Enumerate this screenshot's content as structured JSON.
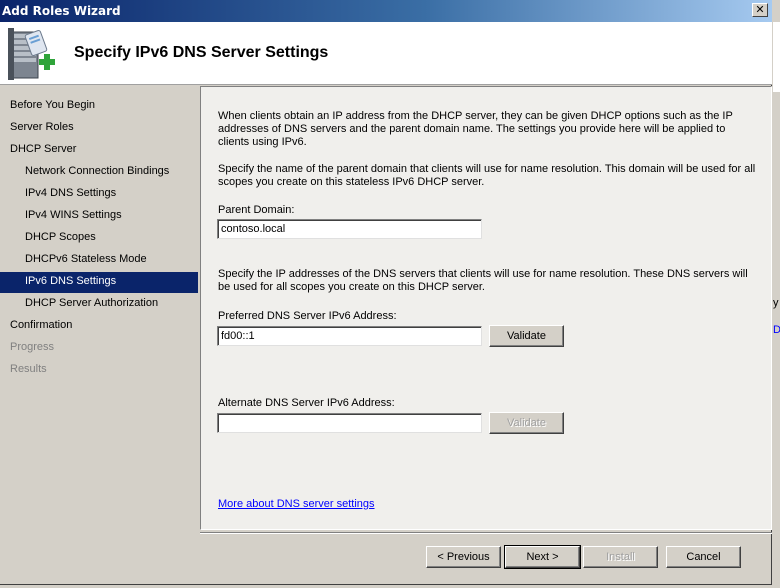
{
  "window": {
    "title": "Add Roles Wizard",
    "close_glyph": "✕"
  },
  "header": {
    "title": "Specify IPv6 DNS Server Settings",
    "icon": "server-add-role-icon"
  },
  "nav": {
    "items": [
      {
        "label": "Before You Begin",
        "level": 1,
        "state": "normal"
      },
      {
        "label": "Server Roles",
        "level": 1,
        "state": "normal"
      },
      {
        "label": "DHCP Server",
        "level": 1,
        "state": "normal"
      },
      {
        "label": "Network Connection Bindings",
        "level": 2,
        "state": "normal"
      },
      {
        "label": "IPv4 DNS Settings",
        "level": 2,
        "state": "normal"
      },
      {
        "label": "IPv4 WINS Settings",
        "level": 2,
        "state": "normal"
      },
      {
        "label": "DHCP Scopes",
        "level": 2,
        "state": "normal"
      },
      {
        "label": "DHCPv6 Stateless Mode",
        "level": 2,
        "state": "normal"
      },
      {
        "label": "IPv6 DNS Settings",
        "level": 2,
        "state": "selected"
      },
      {
        "label": "DHCP Server Authorization",
        "level": 2,
        "state": "normal"
      },
      {
        "label": "Confirmation",
        "level": 1,
        "state": "normal"
      },
      {
        "label": "Progress",
        "level": 1,
        "state": "disabled"
      },
      {
        "label": "Results",
        "level": 1,
        "state": "disabled"
      }
    ]
  },
  "content": {
    "intro": "When clients obtain an IP address from the DHCP server, they can be given DHCP options such as the IP addresses of DNS servers and the parent domain name. The settings you provide here will be applied to clients using IPv6.",
    "domain_instructions": "Specify the name of the parent domain that clients will use for name resolution. This domain will be used for all scopes you create on this stateless IPv6 DHCP server.",
    "parent_domain_label": "Parent Domain:",
    "parent_domain_value": "contoso.local",
    "dns_instructions": "Specify the IP addresses of the DNS servers that clients will use for name resolution. These DNS servers will be used for all scopes you create on this DHCP server.",
    "preferred_label": "Preferred DNS Server IPv6 Address:",
    "preferred_value": "fd00::1",
    "alternate_label": "Alternate DNS Server IPv6 Address:",
    "alternate_value": "",
    "validate_label": "Validate",
    "more_link": "More about DNS server settings"
  },
  "footer": {
    "previous": "< Previous",
    "next": "Next >",
    "install": "Install",
    "cancel": "Cancel"
  },
  "edge": {
    "frag1": "y",
    "frag2": "D"
  },
  "colors": {
    "selection": "#0a246a",
    "link": "#0000ff",
    "chrome": "#d4d0c8"
  }
}
